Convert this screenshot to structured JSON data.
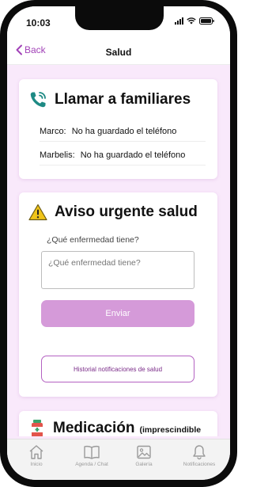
{
  "status_bar": {
    "time": "10:03"
  },
  "nav": {
    "back_label": "Back",
    "title": "Salud"
  },
  "family_card": {
    "title": "Llamar a familiares",
    "contacts": [
      {
        "name": "Marco:",
        "status": "No ha guardado el teléfono"
      },
      {
        "name": "Marbelis:",
        "status": "No ha guardado el teléfono"
      }
    ]
  },
  "urgent_card": {
    "title": "Aviso urgente salud",
    "question": "¿Qué enfermedad tiene?",
    "input_placeholder": "¿Qué enfermedad tiene?",
    "input_value": "",
    "send_label": "Enviar",
    "history_label": "Historial notificaciones de salud"
  },
  "medication_card": {
    "title": "Medicación",
    "subtitle": "(imprescindible"
  },
  "tab_bar": {
    "tabs": [
      {
        "label": "Inicio",
        "icon": "home-icon"
      },
      {
        "label": "Agenda / Chat",
        "icon": "book-icon"
      },
      {
        "label": "Galería",
        "icon": "gallery-icon"
      },
      {
        "label": "Notificaciones",
        "icon": "bell-icon"
      }
    ]
  },
  "colors": {
    "accent": "#a243b8",
    "screen_background": "#f9e9fb",
    "send_button": "#d59ad9",
    "phone_icon": "#1e8a84",
    "warning_icon": "#f0c419"
  }
}
